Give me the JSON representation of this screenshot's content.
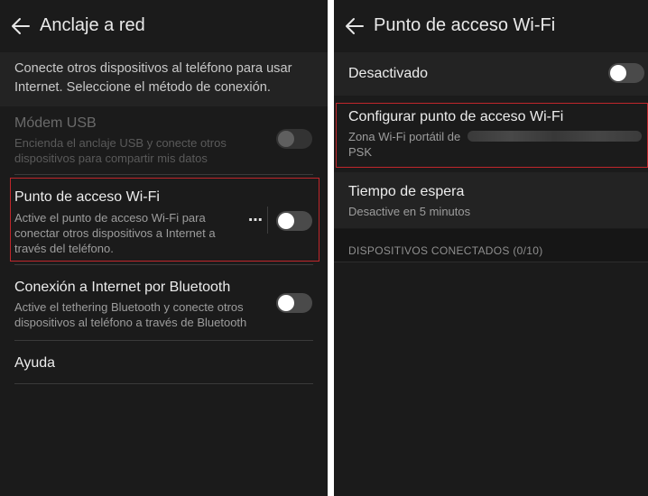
{
  "left": {
    "title": "Anclaje a red",
    "intro": "Conecte otros dispositivos al teléfono para usar Internet. Seleccione el método de conexión.",
    "usb": {
      "title": "Módem USB",
      "desc": "Encienda el anclaje USB y conecte otros dispositivos para compartir mis datos",
      "enabled": false,
      "on": false
    },
    "hotspot": {
      "title": "Punto de acceso Wi-Fi",
      "desc": "Active el punto de acceso Wi-Fi para conectar otros dispositivos a Internet a través del teléfono.",
      "more": "⋯",
      "on": false
    },
    "bluetooth": {
      "title": "Conexión a Internet por Bluetooth",
      "desc": "Active el tethering Bluetooth y conecte otros dispositivos al teléfono a través de Bluetooth",
      "on": false
    },
    "help": "Ayuda"
  },
  "right": {
    "title": "Punto de acceso Wi-Fi",
    "status": {
      "label": "Desactivado",
      "on": false
    },
    "configure": {
      "title": "Configurar punto de acceso Wi-Fi",
      "desc_line1": "Zona Wi-Fi portátil de",
      "desc_line2": "PSK"
    },
    "timeout": {
      "title": "Tiempo de espera",
      "desc": "Desactive en 5 minutos"
    },
    "connected_header": "DISPOSITIVOS CONECTADOS (0/10)"
  },
  "colors": {
    "background": "#1b1b1b",
    "highlight": "#c0262b",
    "text": "#ececec",
    "secondary_text": "#9d9d9d"
  },
  "icons": [
    "back-arrow-icon",
    "more-dots-icon"
  ]
}
